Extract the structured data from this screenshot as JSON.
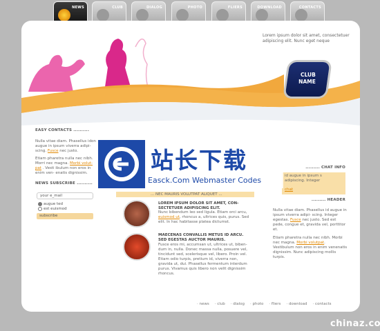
{
  "nav": [
    "NEWS",
    "CLUB",
    "DIALOG",
    "PHOTO",
    "FLIERS",
    "DOWNLOAD",
    "CONTACTS"
  ],
  "hero": {
    "tagline": "Lorem ipsum dolor sit amet, consectetuer adipiscing elit. Nunc eget neque"
  },
  "club_badge": {
    "line1": "CLUB",
    "line2": "NAME"
  },
  "left": {
    "contacts_title": "EASY CONTACTS ..........",
    "contacts_text1": "Nulla vitae diam. Phasellus idon augue in ipsum viverra adipi- scing.",
    "contacts_link1": "Fusce",
    "contacts_text1b": "nec justo.",
    "contacts_text2": "Etiam pharetra nulla nec nibh. Morri nec magna.",
    "contacts_link2": "Morbi volut- pat",
    "contacts_text2b": ". Vesti ibulum non eros in enim ven- enatis dignissim.",
    "newsletter_title": "NEWS SUBSCRIBE ..........",
    "email_placeholder": "your e_mail",
    "radio1": "augue ted",
    "radio2": "est euismod",
    "subscribe": "subscribe"
  },
  "watermark": {
    "cn": "站长下载",
    "en": "Easck.Com Webmaster Codes"
  },
  "center": {
    "art1_title": "LOREM IPSUM DOLOR SIT AMET, CON- SECTETUER ADIPISCING ELIT.",
    "art1_text_a": "Nunc bibendum leo sed ligula. Etiam orci arcu,",
    "art1_link": "euismod ut",
    "art1_text_b": ", rhoncus a, ultrices quis, purus. Sed elit. In hac habitasse platea dictumst.",
    "art2_title": "MAECENAS CONVALLIS METUS ID ARCU. SED EGESTAS AUCTOR MAURIS.",
    "art2_text": "Fusce eros mi, accumsan ut, ultrices ut, biben- dum in, nulla. Donec massa nulla, posuere vel, tincidunt sed, scelerisque vel, libero. Proin vel. Etiam odio turpis, pretium id, viverra non, gravida ut, dui. Phasellus fermentum interdum purus. Vivamus quis libero non velit dignissim rhoncus.",
    "strip_text": "... NEC MAURIS VOLUTPAT ALIQUET ..."
  },
  "right": {
    "chat_title": "......... CHAT INFO",
    "chat_text": "id augue in ipsum s adipiscing. Integer",
    "chat_link": "chat",
    "header_title": "......... HEADER",
    "header_text1": "Nulla vitae diam. Phasellus id augue in ipsum viverra adipi- scing. Integer egestas.",
    "header_link1": "Fusce",
    "header_text1b": "nec justo. Sed est pede, congue et, gravida vel, porttitor et.",
    "header_text2": "Etiam pharetra nulla nec nibh. Morbi nec magna.",
    "header_link2": "Morbi volutpat",
    "header_text2b": ". Vestibulum non eros in enim venenatis dignissim. Nunc adipiscing mollis turpis."
  },
  "footer": [
    "news",
    "club",
    "dialog",
    "photo",
    "fliers",
    "download",
    "contacts"
  ],
  "brand": "chinaz.com",
  "colors": {
    "accent": "#e08700",
    "band": "#f9dfa8",
    "club": "#1d2f73",
    "watermark": "#1d49a8"
  }
}
